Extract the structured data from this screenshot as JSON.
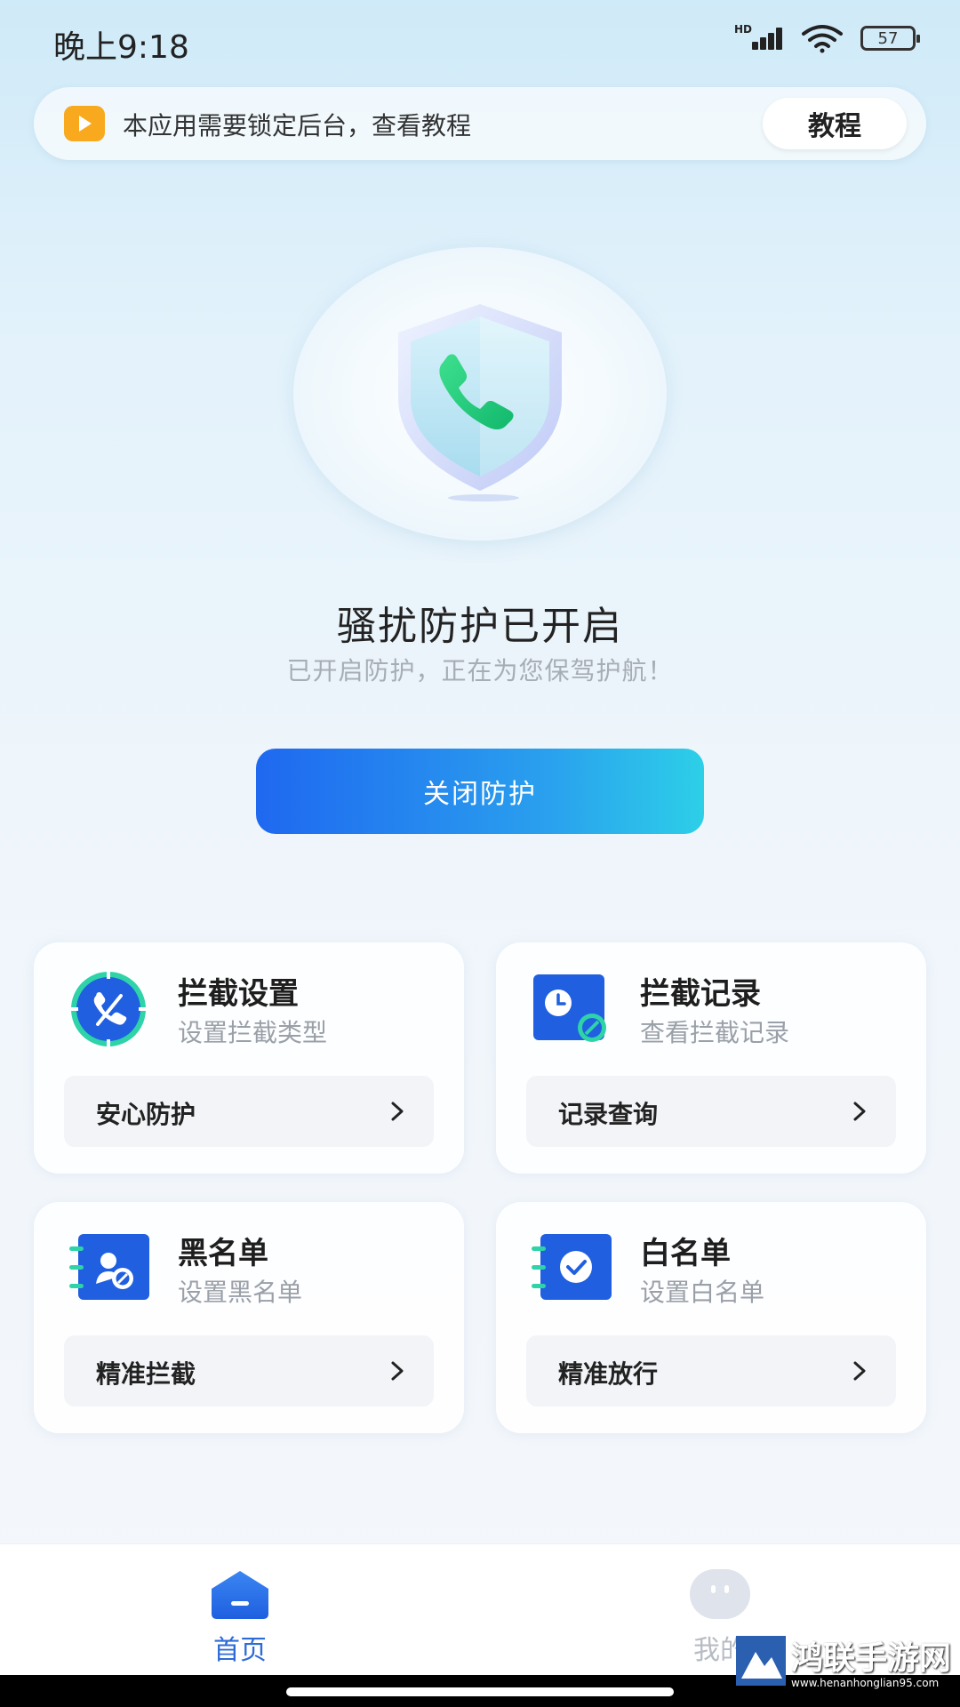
{
  "status_bar": {
    "time": "晚上9:18",
    "network_label": "HD",
    "battery": "57"
  },
  "notice": {
    "icon": "play-icon",
    "text": "本应用需要锁定后台，查看教程",
    "button_label": "教程"
  },
  "hero": {
    "icon": "shield-phone-icon",
    "title": "骚扰防护已开启",
    "subtitle": "已开启防护，正在为您保驾护航！",
    "button_label": "关闭防护"
  },
  "cards": [
    {
      "title": "拦截设置",
      "subtitle": "设置拦截类型",
      "action": "安心防护",
      "icon": "intercept-settings-icon"
    },
    {
      "title": "拦截记录",
      "subtitle": "查看拦截记录",
      "action": "记录查询",
      "icon": "intercept-record-icon"
    },
    {
      "title": "黑名单",
      "subtitle": "设置黑名单",
      "action": "精准拦截",
      "icon": "blacklist-icon"
    },
    {
      "title": "白名单",
      "subtitle": "设置白名单",
      "action": "精准放行",
      "icon": "whitelist-icon"
    }
  ],
  "bottom_nav": {
    "items": [
      {
        "label": "首页",
        "icon": "home-icon",
        "active": true
      },
      {
        "label": "我的",
        "icon": "profile-icon",
        "active": false
      }
    ]
  },
  "watermark": {
    "title": "鸿联手游网",
    "url": "www.henanhonglian95.com"
  },
  "colors": {
    "accent": "#2d6bd6",
    "button_gradient_start": "#1f68f0",
    "button_gradient_end": "#2dcfe8",
    "notice_icon": "#f8a91e"
  }
}
